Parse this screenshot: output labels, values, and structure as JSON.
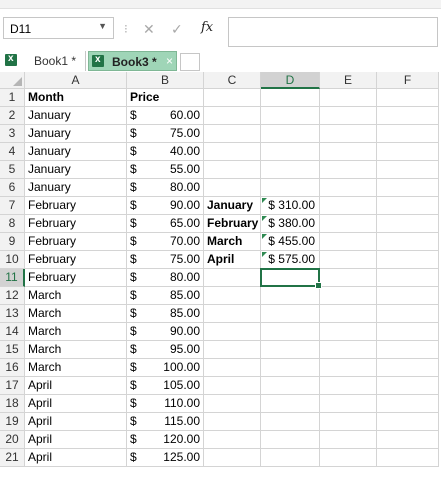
{
  "formula_bar": {
    "name_box": "D11",
    "dropdown_icon": "▼",
    "separator": "⁝",
    "cancel_icon": "✕",
    "enter_icon": "✓",
    "fx_label": "fx",
    "formula_value": ""
  },
  "tabs": [
    {
      "label": "Book1 *"
    },
    {
      "label": "Book3 *",
      "close": "×"
    }
  ],
  "columns": [
    "A",
    "B",
    "C",
    "D",
    "E",
    "F"
  ],
  "rows": [
    {
      "n": "1",
      "a": "Month",
      "b_cur": "",
      "b_val": "Price",
      "c": "",
      "d": ""
    },
    {
      "n": "2",
      "a": "January",
      "b_cur": "$",
      "b_val": "60.00",
      "c": "",
      "d": ""
    },
    {
      "n": "3",
      "a": "January",
      "b_cur": "$",
      "b_val": "75.00",
      "c": "",
      "d": ""
    },
    {
      "n": "4",
      "a": "January",
      "b_cur": "$",
      "b_val": "40.00",
      "c": "",
      "d": ""
    },
    {
      "n": "5",
      "a": "January",
      "b_cur": "$",
      "b_val": "55.00",
      "c": "",
      "d": ""
    },
    {
      "n": "6",
      "a": "January",
      "b_cur": "$",
      "b_val": "80.00",
      "c": "",
      "d": ""
    },
    {
      "n": "7",
      "a": "February",
      "b_cur": "$",
      "b_val": "90.00",
      "c": "January",
      "d": "$ 310.00"
    },
    {
      "n": "8",
      "a": "February",
      "b_cur": "$",
      "b_val": "65.00",
      "c": "February",
      "d": "$ 380.00"
    },
    {
      "n": "9",
      "a": "February",
      "b_cur": "$",
      "b_val": "70.00",
      "c": "March",
      "d": "$ 455.00"
    },
    {
      "n": "10",
      "a": "February",
      "b_cur": "$",
      "b_val": "75.00",
      "c": "April",
      "d": "$ 575.00"
    },
    {
      "n": "11",
      "a": "February",
      "b_cur": "$",
      "b_val": "80.00",
      "c": "",
      "d": ""
    },
    {
      "n": "12",
      "a": "March",
      "b_cur": "$",
      "b_val": "85.00",
      "c": "",
      "d": ""
    },
    {
      "n": "13",
      "a": "March",
      "b_cur": "$",
      "b_val": "85.00",
      "c": "",
      "d": ""
    },
    {
      "n": "14",
      "a": "March",
      "b_cur": "$",
      "b_val": "90.00",
      "c": "",
      "d": ""
    },
    {
      "n": "15",
      "a": "March",
      "b_cur": "$",
      "b_val": "95.00",
      "c": "",
      "d": ""
    },
    {
      "n": "16",
      "a": "March",
      "b_cur": "$",
      "b_val": "100.00",
      "c": "",
      "d": ""
    },
    {
      "n": "17",
      "a": "April",
      "b_cur": "$",
      "b_val": "105.00",
      "c": "",
      "d": ""
    },
    {
      "n": "18",
      "a": "April",
      "b_cur": "$",
      "b_val": "110.00",
      "c": "",
      "d": ""
    },
    {
      "n": "19",
      "a": "April",
      "b_cur": "$",
      "b_val": "115.00",
      "c": "",
      "d": ""
    },
    {
      "n": "20",
      "a": "April",
      "b_cur": "$",
      "b_val": "120.00",
      "c": "",
      "d": ""
    },
    {
      "n": "21",
      "a": "April",
      "b_cur": "$",
      "b_val": "125.00",
      "c": "",
      "d": ""
    }
  ],
  "selected_cell": "D11",
  "colors": {
    "accent": "#217346",
    "active_tab": "#9fd5b7",
    "error_marker": "#2f8a52"
  }
}
